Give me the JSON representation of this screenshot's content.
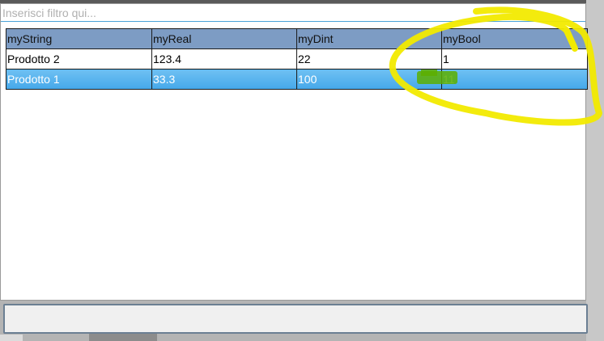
{
  "filter": {
    "placeholder": "Inserisci filtro qui...",
    "value": ""
  },
  "table": {
    "columns": [
      "myString",
      "myReal",
      "myDint",
      "myBool"
    ],
    "rows": [
      {
        "selected": false,
        "cells": [
          "Prodotto 2",
          "123.4",
          "22",
          "1"
        ]
      },
      {
        "selected": true,
        "cells": [
          "Prodotto 1",
          "33.3",
          "100",
          "11"
        ]
      }
    ]
  },
  "colors": {
    "header_bg": "#7d9cc4",
    "selected_row_bg": "#45a8ea",
    "annotation_yellow": "#f2ea00",
    "annotation_green": "#5caf00"
  }
}
